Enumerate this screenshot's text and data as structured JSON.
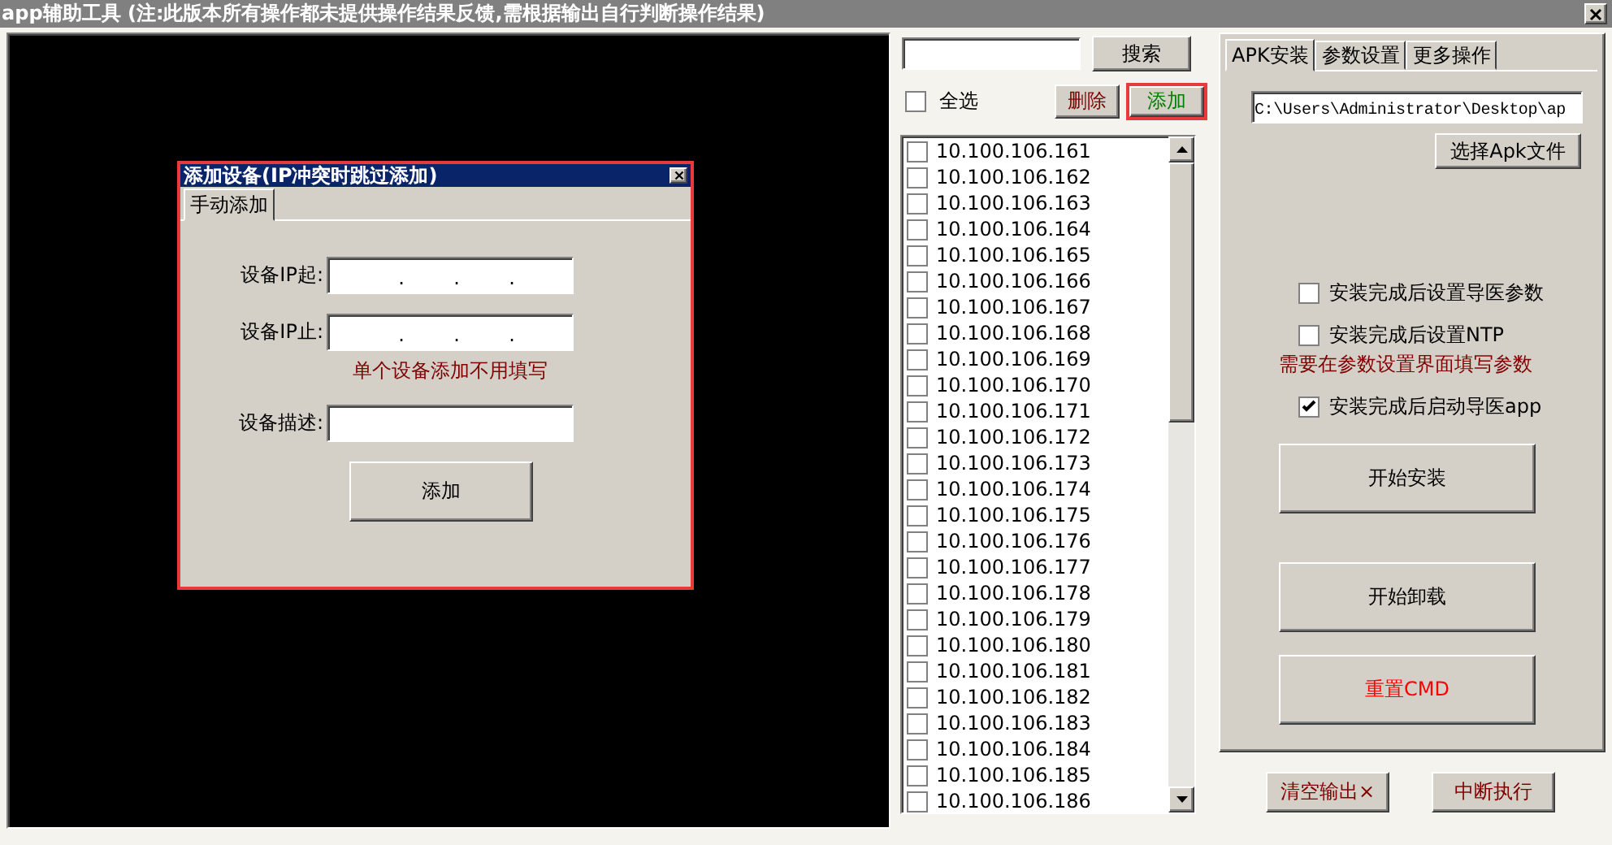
{
  "window": {
    "title": "app辅助工具 (注:此版本所有操作都未提供操作结果反馈,需根据输出自行判断操作结果)"
  },
  "dialog": {
    "title": "添加设备(IP冲突时跳过添加)",
    "tabs": [
      {
        "label": "手动添加",
        "selected": true
      }
    ],
    "fields": [
      {
        "kind": "ip",
        "label": "设备IP起:",
        "separators": [
          ".",
          ".",
          "."
        ]
      },
      {
        "kind": "ip",
        "label": "设备IP止:",
        "separators": [
          ".",
          ".",
          "."
        ],
        "note": "单个设备添加不用填写"
      },
      {
        "kind": "text",
        "label": "设备描述:"
      }
    ],
    "submit": "添加"
  },
  "device_panel": {
    "search_button": "搜索",
    "select_all": {
      "label": "全选",
      "checked": false
    },
    "delete_button": "删除",
    "add_button": "添加",
    "devices": [
      {
        "ip": "10.100.106.161",
        "checked": false
      },
      {
        "ip": "10.100.106.162",
        "checked": false
      },
      {
        "ip": "10.100.106.163",
        "checked": false
      },
      {
        "ip": "10.100.106.164",
        "checked": false
      },
      {
        "ip": "10.100.106.165",
        "checked": false
      },
      {
        "ip": "10.100.106.166",
        "checked": false
      },
      {
        "ip": "10.100.106.167",
        "checked": false
      },
      {
        "ip": "10.100.106.168",
        "checked": false
      },
      {
        "ip": "10.100.106.169",
        "checked": false
      },
      {
        "ip": "10.100.106.170",
        "checked": false
      },
      {
        "ip": "10.100.106.171",
        "checked": false
      },
      {
        "ip": "10.100.106.172",
        "checked": false
      },
      {
        "ip": "10.100.106.173",
        "checked": false
      },
      {
        "ip": "10.100.106.174",
        "checked": false
      },
      {
        "ip": "10.100.106.175",
        "checked": false
      },
      {
        "ip": "10.100.106.176",
        "checked": false
      },
      {
        "ip": "10.100.106.177",
        "checked": false
      },
      {
        "ip": "10.100.106.178",
        "checked": false
      },
      {
        "ip": "10.100.106.179",
        "checked": false
      },
      {
        "ip": "10.100.106.180",
        "checked": false
      },
      {
        "ip": "10.100.106.181",
        "checked": false
      },
      {
        "ip": "10.100.106.182",
        "checked": false
      },
      {
        "ip": "10.100.106.183",
        "checked": false
      },
      {
        "ip": "10.100.106.184",
        "checked": false
      },
      {
        "ip": "10.100.106.185",
        "checked": false
      },
      {
        "ip": "10.100.106.186",
        "checked": false
      }
    ]
  },
  "right_panel": {
    "tabs": [
      {
        "label": "APK安装",
        "selected": true
      },
      {
        "label": "参数设置",
        "selected": false
      },
      {
        "label": "更多操作",
        "selected": false
      }
    ],
    "apk_path": "C:\\Users\\Administrator\\Desktop\\ap",
    "choose_button": "选择Apk文件",
    "options": [
      {
        "label": "安装完成后设置导医参数",
        "checked": false
      },
      {
        "label": "安装完成后设置NTP",
        "checked": false,
        "note": "需要在参数设置界面填写参数"
      },
      {
        "label": "安装完成后启动导医app",
        "checked": true
      }
    ],
    "actions": [
      {
        "label": "开始安装",
        "kind": "normal"
      },
      {
        "label": "开始卸载",
        "kind": "normal"
      },
      {
        "label": "重置CMD",
        "kind": "danger"
      }
    ]
  },
  "footer_buttons": [
    "清空输出×",
    "中断执行"
  ]
}
